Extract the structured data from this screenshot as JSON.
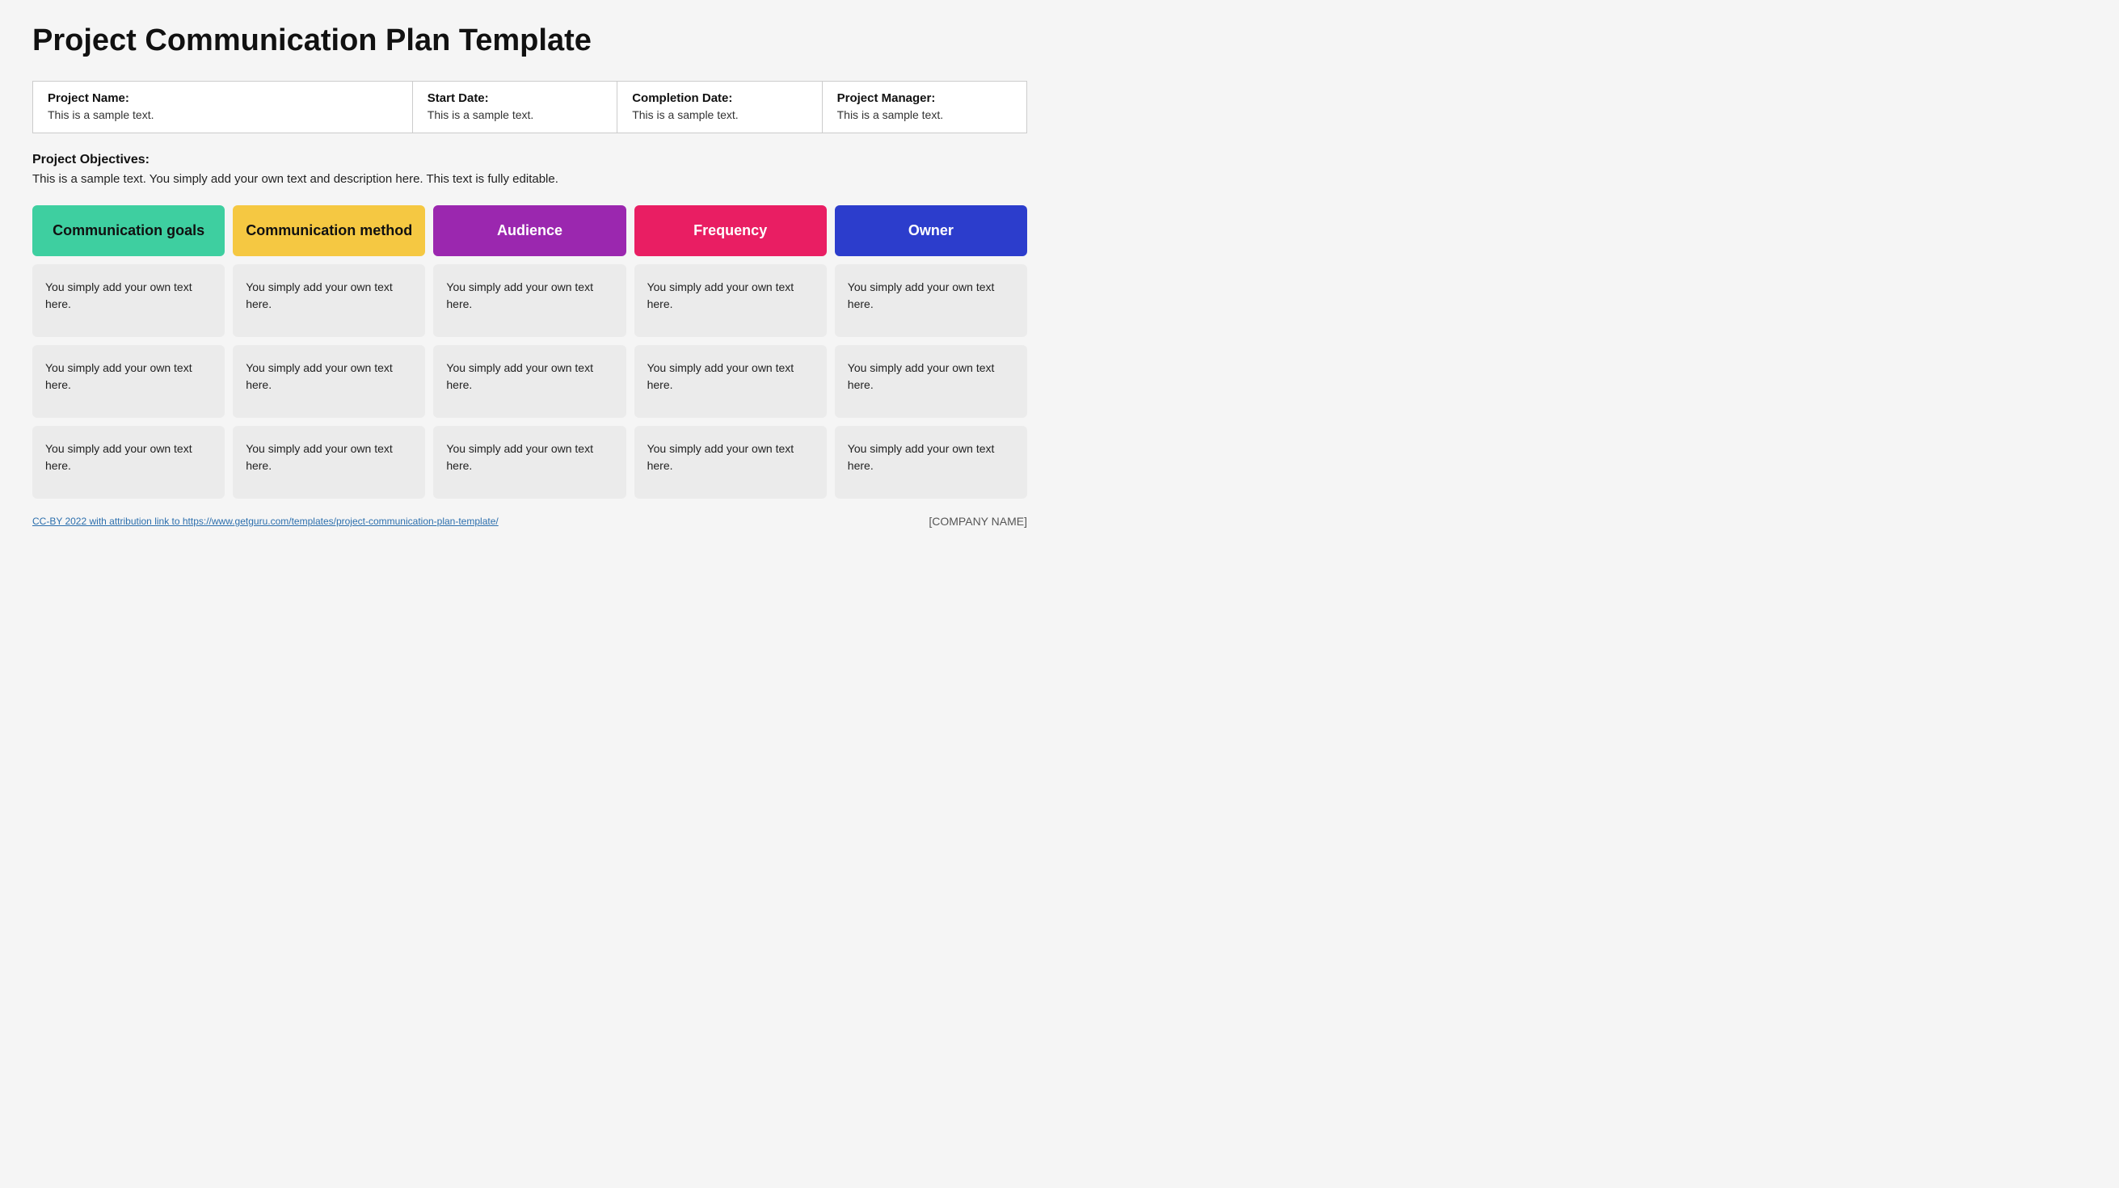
{
  "page": {
    "title": "Project Communication Plan Template"
  },
  "meta": {
    "project_name_label": "Project Name:",
    "project_name_value": "This is a sample text.",
    "start_date_label": "Start Date:",
    "start_date_value": "This is a sample text.",
    "completion_date_label": "Completion Date:",
    "completion_date_value": "This is a sample text.",
    "project_manager_label": "Project Manager:",
    "project_manager_value": "This is a sample text."
  },
  "objectives": {
    "label": "Project Objectives:",
    "text": "This is a sample text. You simply add your own text and description here. This text is fully editable."
  },
  "table": {
    "headers": [
      {
        "id": "goals",
        "label": "Communication goals"
      },
      {
        "id": "method",
        "label": "Communication method"
      },
      {
        "id": "audience",
        "label": "Audience"
      },
      {
        "id": "frequency",
        "label": "Frequency"
      },
      {
        "id": "owner",
        "label": "Owner"
      }
    ],
    "rows": [
      {
        "goals": "You simply add your own text here.",
        "method": "You simply add your own text here.",
        "audience": "You simply add your own text here.",
        "frequency": "You simply add your own text here.",
        "owner": "You simply add your own text here."
      },
      {
        "goals": "You simply add your own text here.",
        "method": "You simply add your own text here.",
        "audience": "You simply add your own text here.",
        "frequency": "You simply add your own text here.",
        "owner": "You simply add your own text here."
      },
      {
        "goals": "You simply add your own text here.",
        "method": "You simply add your own text here.",
        "audience": "You simply add your own text here.",
        "frequency": "You simply add your own text here.",
        "owner": "You simply add your own text here."
      }
    ]
  },
  "footer": {
    "link_text": "CC-BY 2022 with attribution link to https://www.getguru.com/templates/project-communication-plan-template/",
    "company_name": "[COMPANY NAME]"
  }
}
